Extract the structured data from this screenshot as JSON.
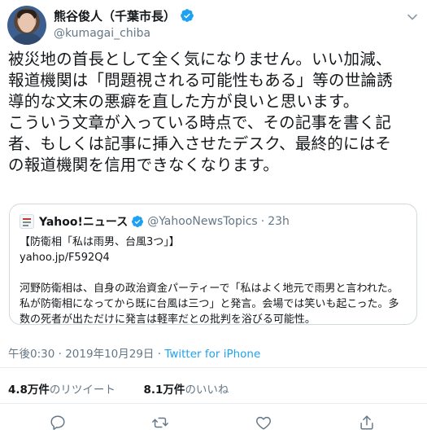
{
  "tweet": {
    "author_name": "熊谷俊人（千葉市長）",
    "author_handle": "@kumagai_chiba",
    "text": "被災地の首長として全く気になりません。いい加減、\n報道機関は「問題視される可能性もある」等の世論誘\n導的な文末の悪癖を直した方が良いと思います。\nこういう文章が入っている時点で、その記事を書く記\n者、もしくは記事に挿入させたデスク、最終的にはそ\nの報道機関を信用できなくなります。",
    "time": "午後0:30",
    "separator": "·",
    "date": "2019年10月29日",
    "source": "Twitter for iPhone"
  },
  "quoted": {
    "name": "Yahoo!ニュース",
    "handle": "@YahooNewsTopics",
    "dot": "·",
    "age": "23h",
    "body": "【防衛相「私は雨男、台風3つ」】\nyahoo.jp/F592Q4\n\n河野防衛相は、自身の政治資金パーティーで「私はよく地元で雨男と言われた。\n私が防衛相になってから既に台風は三つ」と発言。会場では笑いも起こった。多\n数の死者が出ただけに発言は軽率だとの批判を浴びる可能性。"
  },
  "stats": {
    "retweets_count": "4.8万件",
    "retweets_label": "のリツイート",
    "likes_count": "8.1万件",
    "likes_label": "のいいね"
  },
  "colors": {
    "accent": "#1da1f2",
    "muted": "#657786",
    "border": "#cfd9de"
  },
  "icons": [
    "verified-badge-icon",
    "chevron-down-icon",
    "reply-icon",
    "retweet-icon",
    "like-icon",
    "share-icon"
  ]
}
